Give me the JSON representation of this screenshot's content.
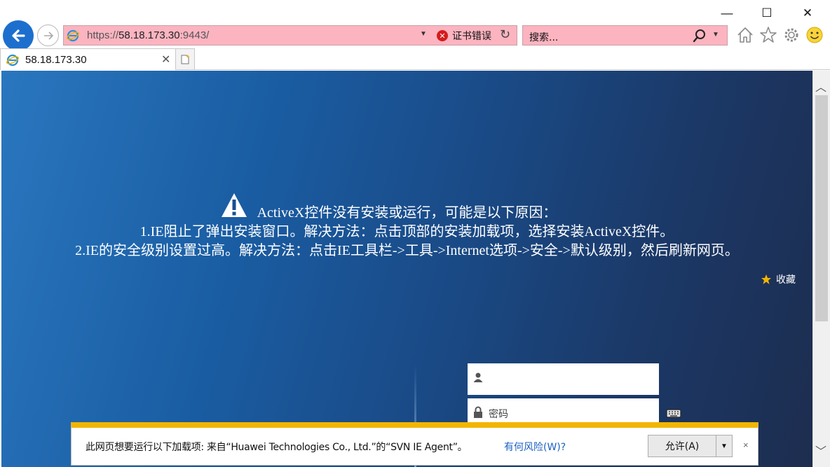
{
  "window_controls": {
    "minimize": "—",
    "maximize": "☐",
    "close": "✕"
  },
  "address_bar": {
    "url_scheme": "https://",
    "url_host": "58.18.173.30",
    "url_rest": ":9443/",
    "cert_error_label": "证书错误"
  },
  "search": {
    "placeholder": "搜索..."
  },
  "tab": {
    "title": "58.18.173.30",
    "close_label": "✕"
  },
  "page": {
    "activex_line1": "ActiveX控件没有安装或运行，可能是以下原因：",
    "activex_line2": "1.IE阻止了弹出安装窗口。解决方法：点击顶部的安装加载项，选择安装ActiveX控件。",
    "activex_line3": "2.IE的安全级别设置过高。解决方法：点击IE工具栏->工具->Internet选项->安全->默认级别，然后刷新网页。",
    "favorite_label": "收藏",
    "password_placeholder": "密码"
  },
  "notification": {
    "message": "此网页想要运行以下加载项: 来自“Huawei Technologies Co., Ltd.”的“SVN IE Agent”。",
    "risk_link": "有何风险(W)?",
    "allow_button": "允许(A)",
    "close_label": "×"
  },
  "colors": {
    "address_bar_error_bg": "#fbb4c0",
    "back_button": "#1d6fce",
    "notification_accent": "#f2b500",
    "page_gradient_start": "#2a77bf",
    "page_gradient_end": "#1d2d4f"
  }
}
